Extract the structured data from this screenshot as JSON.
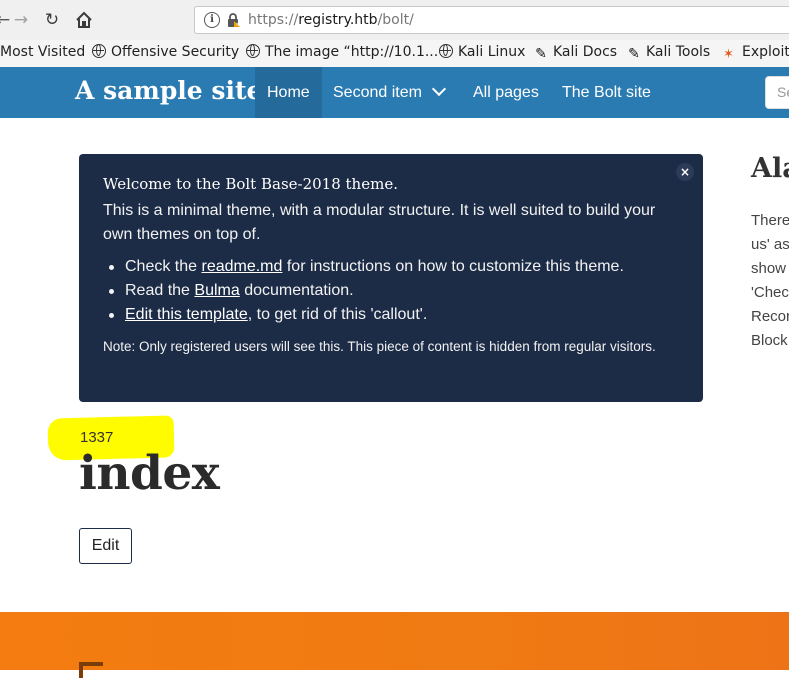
{
  "browser": {
    "url_scheme": "https://",
    "url_host": "registry.htb",
    "url_path": "/bolt/",
    "icons": {
      "back": "back-arrow-icon",
      "forward": "forward-arrow-icon",
      "reload": "reload-icon",
      "home": "home-icon",
      "info": "info-icon",
      "lock": "lock-icon"
    }
  },
  "bookmarks": [
    {
      "label": "Most Visited",
      "icon": "none"
    },
    {
      "label": "Offensive Security",
      "icon": "globe-icon"
    },
    {
      "label": "The image “http://10.1...",
      "icon": "globe-icon"
    },
    {
      "label": "Kali Linux",
      "icon": "globe-icon"
    },
    {
      "label": "Kali Docs",
      "icon": "kali-dragon-icon"
    },
    {
      "label": "Kali Tools",
      "icon": "kali-dragon-icon"
    },
    {
      "label": "Exploit",
      "icon": "exploit-db-icon"
    }
  ],
  "site": {
    "brand": "A sample site",
    "nav": [
      "Home",
      "Second item",
      "All pages",
      "The Bolt site"
    ],
    "search_placeholder": "Se",
    "nav_color": "#2a7bb2",
    "nav_active_color": "#246a9b"
  },
  "callout": {
    "title": "Welcome to the Bolt Base-2018 theme.",
    "intro": "This is a minimal theme, with a modular structure. It is well suited to build your own themes on top of.",
    "items": [
      {
        "before": "Check the ",
        "link": "readme.md",
        "after": " for instructions on how to customize this theme."
      },
      {
        "before": "Read the ",
        "link": "Bulma",
        "after": " documentation."
      },
      {
        "before": "",
        "link": "Edit this template",
        "after": ", to get rid of this 'callout'."
      }
    ],
    "note": "Note: Only registered users will see this. This piece of content is hidden from regular visitors.",
    "close": "×",
    "bg_color": "#1c2b46"
  },
  "sidebar": {
    "title": "Ala",
    "lines": [
      "There",
      "us' as",
      "show",
      "'Chec",
      "Recor",
      "Block"
    ]
  },
  "content": {
    "number": "1337",
    "heading": "index",
    "edit_label": "Edit",
    "highlight_color": "#fffc00"
  },
  "footer": {
    "color": "#f47c10"
  }
}
